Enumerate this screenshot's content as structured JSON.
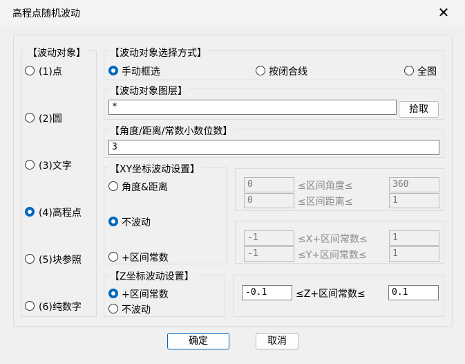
{
  "window": {
    "title": "高程点随机波动"
  },
  "target": {
    "title": "【波动对象】",
    "options": [
      "(1)点",
      "(2)圆",
      "(3)文字",
      "(4)高程点",
      "(5)块参照",
      "(6)纯数字"
    ],
    "selected": "(4)高程点"
  },
  "method": {
    "title": "【波动对象选择方式】",
    "options": [
      "手动框选",
      "按闭合线",
      "全图"
    ],
    "selected": "手动框选"
  },
  "layer": {
    "title": "【波动对象图层】",
    "value": "*",
    "pick_button": "拾取"
  },
  "decimals": {
    "title": "【角度/距离/常数小数位数】",
    "value": "3"
  },
  "xy": {
    "title": "【XY坐标波动设置】",
    "options": [
      "角度&距离",
      "不波动",
      "+区间常数"
    ],
    "selected": "不波动",
    "angle": {
      "min": "0",
      "label": "≤区间角度≤",
      "max": "360"
    },
    "distance": {
      "min": "0",
      "label": "≤区间距离≤",
      "max": "1"
    },
    "x_const": {
      "min": "-1",
      "label": "≤X+区间常数≤",
      "max": "1"
    },
    "y_const": {
      "min": "-1",
      "label": "≤Y+区间常数≤",
      "max": "1"
    }
  },
  "z": {
    "title": "【Z坐标波动设置】",
    "options": [
      "+区间常数",
      "不波动"
    ],
    "selected": "+区间常数",
    "const": {
      "min": "-0.1",
      "label": "≤Z+区间常数≤",
      "max": "0.1"
    }
  },
  "buttons": {
    "ok": "确定",
    "cancel": "取消"
  }
}
